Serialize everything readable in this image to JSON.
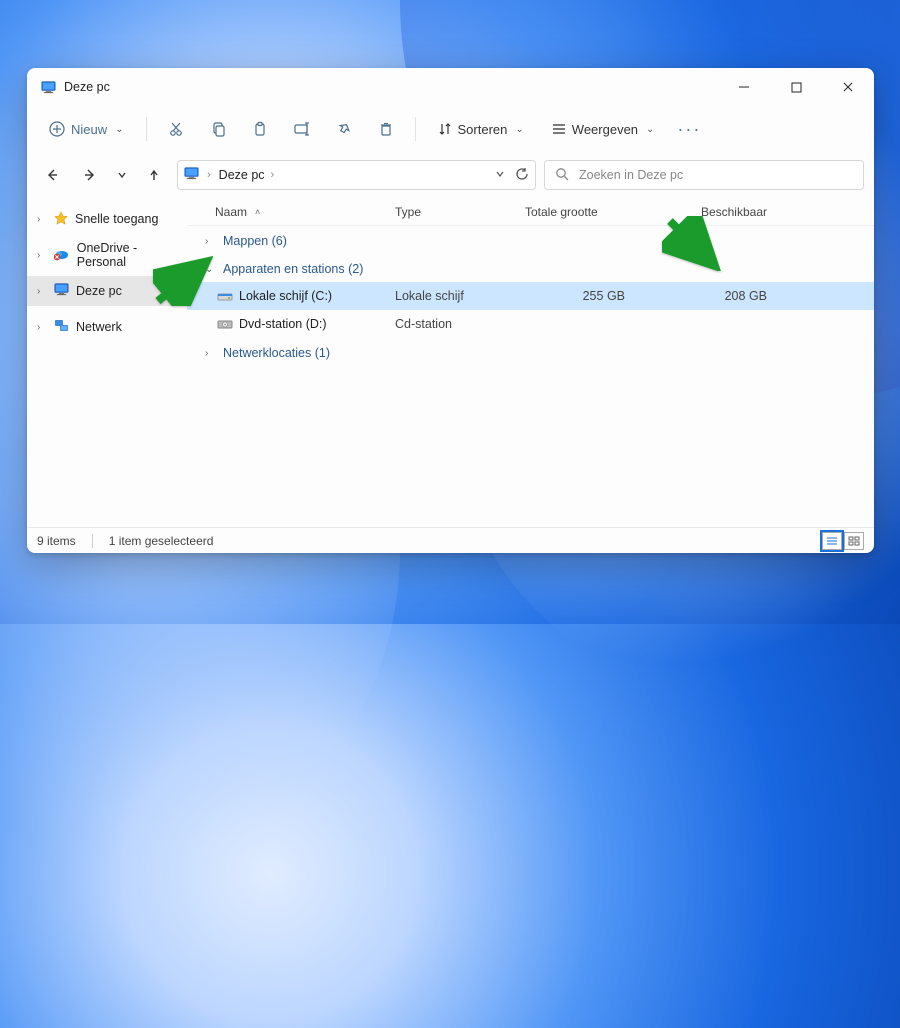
{
  "title": "Deze pc",
  "toolbar": {
    "new_label": "Nieuw",
    "sort_label": "Sorteren",
    "view_label": "Weergeven"
  },
  "address": {
    "crumb1": "Deze pc"
  },
  "search": {
    "placeholder": "Zoeken in Deze pc"
  },
  "sidebar": {
    "items": [
      {
        "label": "Snelle toegang"
      },
      {
        "label": "OneDrive - Personal"
      },
      {
        "label": "Deze pc"
      },
      {
        "label": "Netwerk"
      }
    ]
  },
  "columns": {
    "name": "Naam",
    "type": "Type",
    "total": "Totale grootte",
    "avail": "Beschikbaar"
  },
  "groups": {
    "folders": "Mappen (6)",
    "devices": "Apparaten en stations (2)",
    "network": "Netwerklocaties (1)"
  },
  "rows": {
    "drive_c": {
      "name": "Lokale schijf (C:)",
      "type": "Lokale schijf",
      "total": "255 GB",
      "avail": "208 GB"
    },
    "drive_d": {
      "name": "Dvd-station (D:)",
      "type": "Cd-station",
      "total": "",
      "avail": ""
    }
  },
  "status": {
    "items": "9 items",
    "selected": "1 item geselecteerd"
  }
}
